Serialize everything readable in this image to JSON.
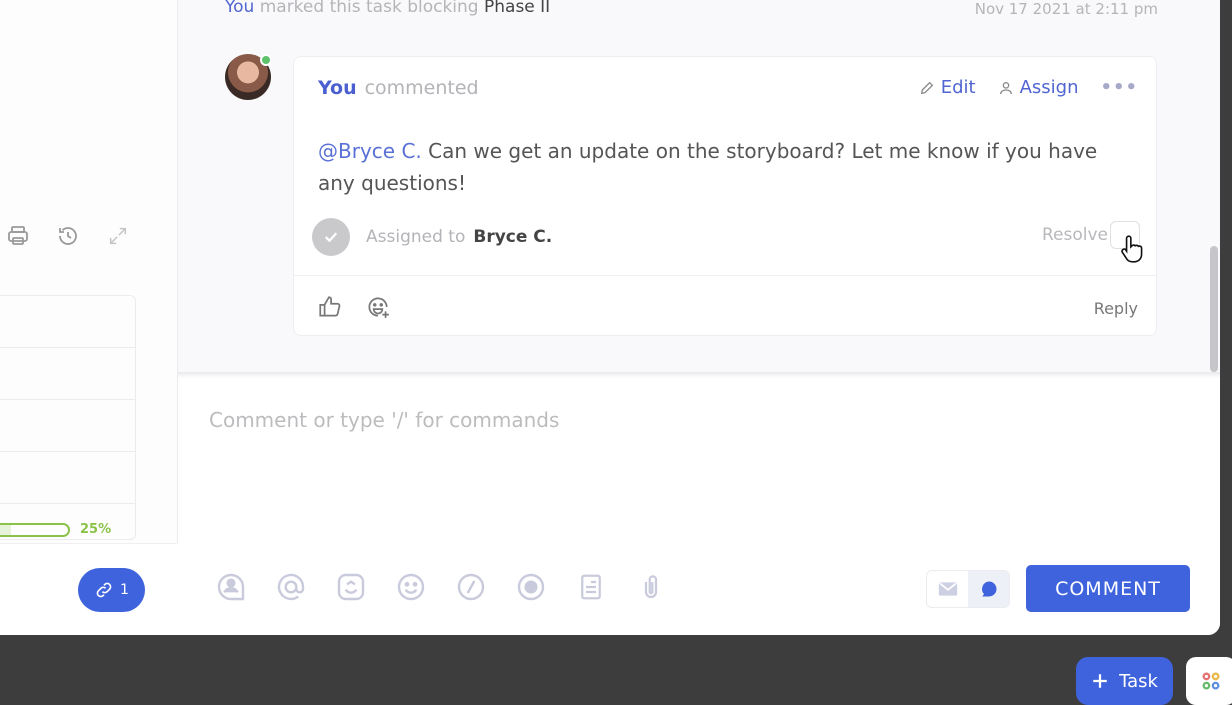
{
  "activity": {
    "actor": "You",
    "action": "marked this task blocking",
    "target": "Phase II",
    "timestamp": "Nov 17 2021 at 2:11 pm"
  },
  "comment": {
    "author": "You",
    "verb": "commented",
    "avatar_status": "online",
    "actions": {
      "edit_label": "Edit",
      "assign_label": "Assign",
      "more_label": "•••"
    },
    "mention": "@Bryce C.",
    "body": " Can we get an update on the storyboard? Let me know if you have any questions!",
    "assigned_label": "Assigned to",
    "assignee": "Bryce C.",
    "resolve_label": "Resolve",
    "reply_label": "Reply"
  },
  "left_pane": {
    "progress_percent": 25,
    "progress_label": "25%",
    "link_count": "1"
  },
  "composer": {
    "placeholder": "Comment or type '/' for commands",
    "submit_label": "COMMENT",
    "mode_active": "comment"
  },
  "bottom_bar": {
    "task_label": "Task"
  },
  "colors": {
    "accent": "#3f63dc",
    "mention": "#5a71d6",
    "progress": "#8bc34a",
    "online": "#5cc26b"
  }
}
